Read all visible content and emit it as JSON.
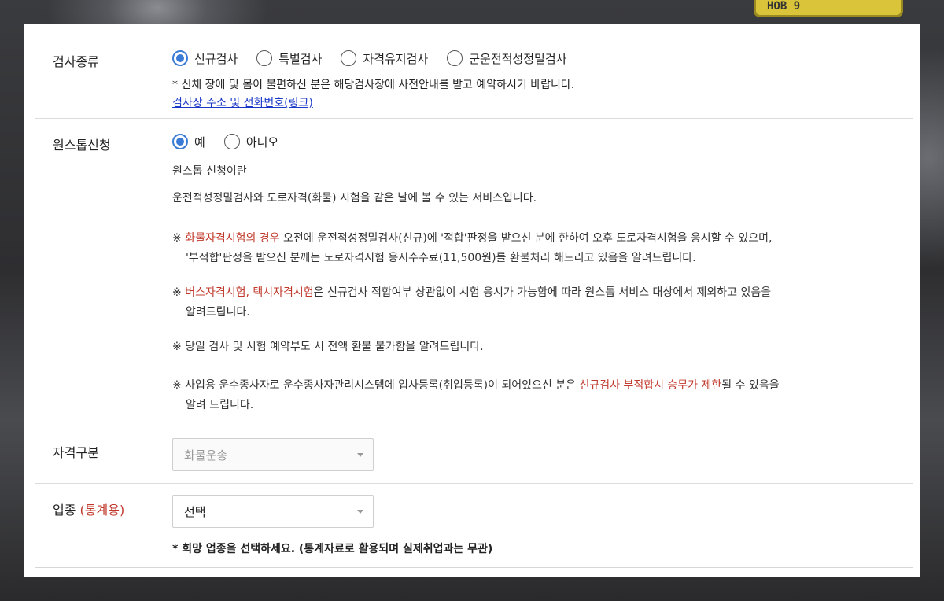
{
  "plate": {
    "text": "HOB 9"
  },
  "exam_type": {
    "label": "검사종류",
    "options": [
      {
        "label": "신규검사",
        "selected": true
      },
      {
        "label": "특별검사",
        "selected": false
      },
      {
        "label": "자격유지검사",
        "selected": false
      },
      {
        "label": "군운전적성정밀검사",
        "selected": false
      }
    ],
    "note": "* 신체 장애 및 몸이 불편하신 분은 해당검사장에 사전안내를 받고 예약하시기 바랍니다.",
    "link": "검사장 주소 및 전화번호(링크)"
  },
  "one_stop": {
    "label": "원스톱신청",
    "options": [
      {
        "label": "예",
        "selected": true
      },
      {
        "label": "아니오",
        "selected": false
      }
    ],
    "intro_title": "원스톱 신청이란",
    "intro_text": "운전적성정밀검사와 도로자격(화물) 시험을 같은 날에 볼 수 있는 서비스입니다.",
    "notice1": {
      "prefix": "※ ",
      "highlight": "화물자격시험의 경우",
      "rest": " 오전에 운전적성정밀검사(신규)에 '적합'판정을 받으신 분에 한하여 오후 도로자격시험을 응시할 수 있으며,",
      "line2": "'부적합'판정을 받으신 분께는 도로자격시험 응시수수료(11,500원)를 환불처리 해드리고 있음을 알려드립니다."
    },
    "notice2": {
      "prefix": "※ ",
      "highlight": "버스자격시험, 택시자격시험",
      "rest": "은 신규검사 적합여부 상관없이 시험 응시가 가능함에 따라 원스톱 서비스 대상에서 제외하고 있음을",
      "line2": "알려드립니다."
    },
    "notice3": "※ 당일 검사 및 시험 예약부도 시 전액 환불 불가함을 알려드립니다.",
    "notice4": {
      "prefix": "※ 사업용 운수종사자로 운수종사자관리시스템에 입사등록(취업등록)이 되어있으신 분은 ",
      "highlight": "신규검사 부적합시 승무가 제한",
      "rest": "될 수 있음을",
      "line2": "알려 드립니다."
    }
  },
  "qualification": {
    "label": "자격구분",
    "value": "화물운송"
  },
  "industry": {
    "label": "업종",
    "label_suffix": "(통계용)",
    "value": "선택",
    "note": "* 희망 업종을 선택하세요. (통계자료로 활용되며 실제취업과는 무관)"
  },
  "colors": {
    "accent": "#3a7bd5",
    "highlight": "#c0392b",
    "link": "#1a38c7"
  }
}
